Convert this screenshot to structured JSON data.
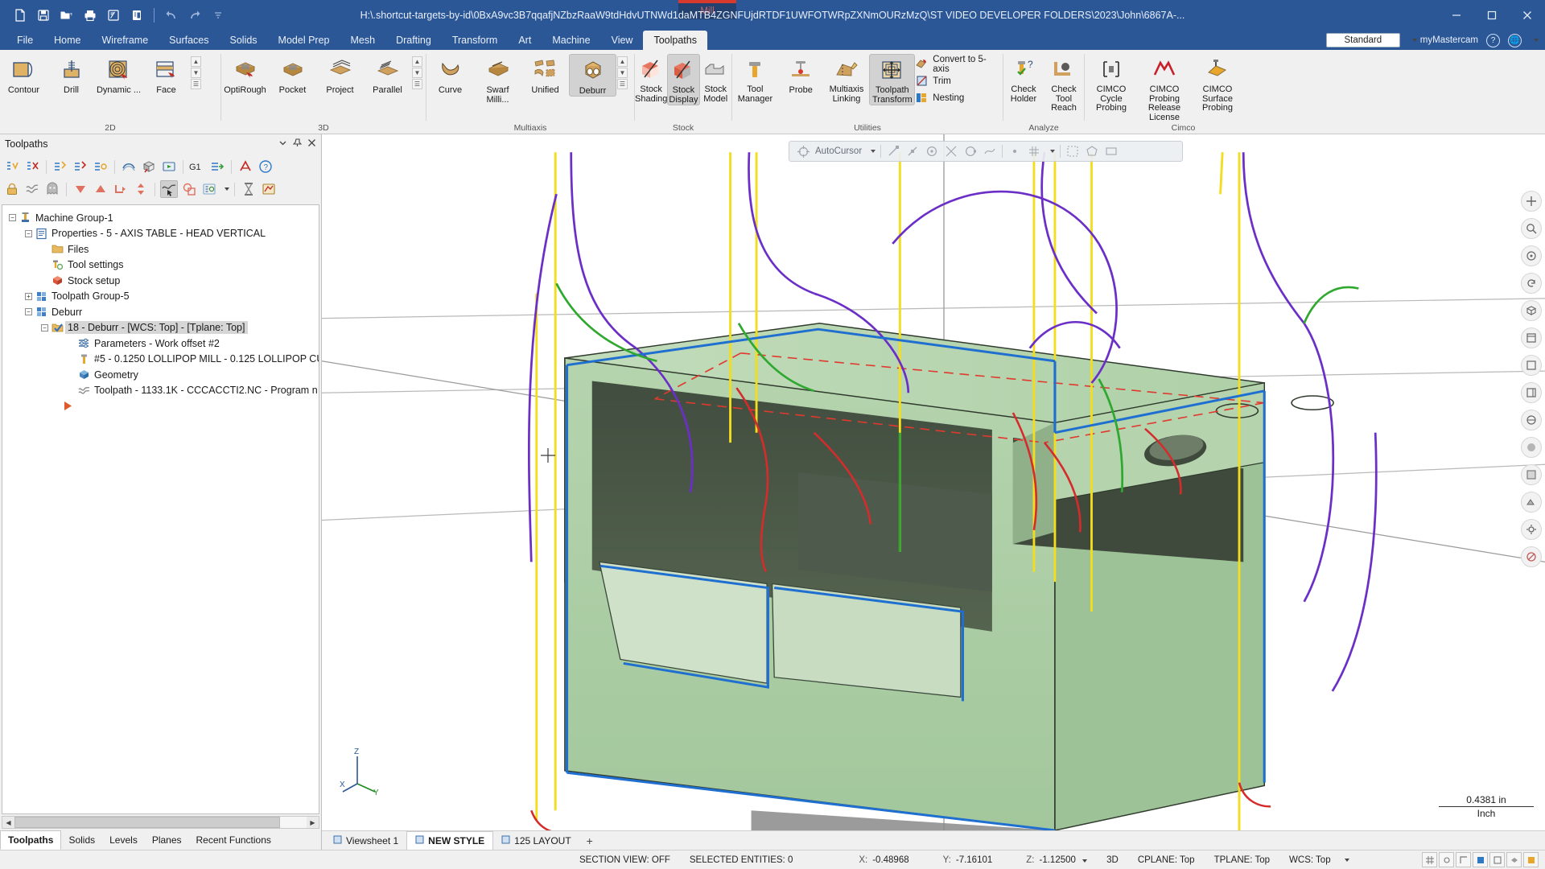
{
  "window": {
    "file_path": "H:\\.shortcut-targets-by-id\\0BxA9vc3B7qqafjNZbzRaaW9tdHdvUTNWd1daMTB4ZGNFUjdRTDF1UWFOTWRpZXNmOURzMzQ\\ST VIDEO DEVELOPER FOLDERS\\2023\\John\\6867A-...",
    "mill_tab": "Mill",
    "minimize": "–",
    "maximize": "❐",
    "close": "✕"
  },
  "quick_access": [
    {
      "name": "new-file",
      "icon": "document-icon"
    },
    {
      "name": "save",
      "icon": "floppy-icon"
    },
    {
      "name": "open",
      "icon": "folder-open-icon"
    },
    {
      "name": "print",
      "icon": "printer-icon"
    },
    {
      "name": "edit-notes",
      "icon": "note-check-icon"
    },
    {
      "name": "report",
      "icon": "report-icon"
    },
    {
      "name": "undo",
      "icon": "undo-icon"
    },
    {
      "name": "redo",
      "icon": "redo-icon"
    },
    {
      "name": "customize",
      "icon": "overflow-icon"
    }
  ],
  "ribbon_tabs": [
    {
      "label": "File",
      "active": false
    },
    {
      "label": "Home",
      "active": false
    },
    {
      "label": "Wireframe",
      "active": false
    },
    {
      "label": "Surfaces",
      "active": false
    },
    {
      "label": "Solids",
      "active": false
    },
    {
      "label": "Model Prep",
      "active": false
    },
    {
      "label": "Mesh",
      "active": false
    },
    {
      "label": "Drafting",
      "active": false
    },
    {
      "label": "Transform",
      "active": false
    },
    {
      "label": "Art",
      "active": false
    },
    {
      "label": "Machine",
      "active": false
    },
    {
      "label": "View",
      "active": false
    },
    {
      "label": "Toolpaths",
      "active": true
    }
  ],
  "tabstrip_right": {
    "config_selector": "Standard",
    "account": "myMastercam",
    "help_icon": "question-circle-icon",
    "globe_icon": "globe-icon",
    "caret_icon": "chevron-down-icon"
  },
  "ribbon_groups": [
    {
      "name": "2D",
      "label": "2D",
      "buttons": [
        {
          "label": "Contour",
          "icon": "contour-icon"
        },
        {
          "label": "Drill",
          "icon": "drill-icon"
        },
        {
          "label": "Dynamic ...",
          "icon": "dynamic-mill-icon"
        },
        {
          "label": "Face",
          "icon": "face-icon"
        }
      ],
      "has_scroll": true
    },
    {
      "name": "3D",
      "label": "3D",
      "buttons": [
        {
          "label": "OptiRough",
          "icon": "optirough-icon"
        },
        {
          "label": "Pocket",
          "icon": "pocket-3d-icon"
        },
        {
          "label": "Project",
          "icon": "project-icon"
        },
        {
          "label": "Parallel",
          "icon": "parallel-icon"
        }
      ],
      "has_scroll": true
    },
    {
      "name": "Multiaxis",
      "label": "Multiaxis",
      "buttons": [
        {
          "label": "Curve",
          "icon": "curve-icon"
        },
        {
          "label": "Swarf Milli...",
          "icon": "swarf-icon"
        },
        {
          "label": "Unified",
          "icon": "unified-icon"
        },
        {
          "label": "Deburr",
          "icon": "deburr-icon",
          "selected": true
        }
      ],
      "has_scroll": true
    },
    {
      "name": "Stock",
      "label": "Stock",
      "buttons": [
        {
          "label": "Stock Shading",
          "icon": "stock-shading-icon"
        },
        {
          "label": "Stock Display",
          "icon": "stock-display-icon",
          "selected": true
        },
        {
          "label": "Stock Model",
          "icon": "stock-model-icon",
          "dropdown": true
        }
      ]
    },
    {
      "name": "Utilities",
      "label": "Utilities",
      "buttons": [
        {
          "label": "Tool Manager",
          "icon": "tool-manager-icon"
        },
        {
          "label": "Probe",
          "icon": "probe-icon"
        },
        {
          "label": "Multiaxis Linking",
          "icon": "multiaxis-linking-icon"
        },
        {
          "label": "Toolpath Transform",
          "icon": "toolpath-transform-icon"
        }
      ],
      "small_buttons": [
        {
          "label": "Convert to 5-axis",
          "icon": "convert-5axis-icon"
        },
        {
          "label": "Trim",
          "icon": "trim-icon"
        },
        {
          "label": "Nesting",
          "icon": "nesting-icon"
        }
      ]
    },
    {
      "name": "Analyze",
      "label": "Analyze",
      "buttons": [
        {
          "label": "Check Holder",
          "icon": "check-holder-icon"
        },
        {
          "label": "Check Tool Reach",
          "icon": "check-tool-reach-icon"
        }
      ]
    },
    {
      "name": "Cimco",
      "label": "Cimco",
      "buttons": [
        {
          "label": "CIMCO Cycle Probing",
          "icon": "cimco-cycle-probing-icon"
        },
        {
          "label": "CIMCO Probing Release License",
          "icon": "cimco-release-license-icon"
        },
        {
          "label": "CIMCO Surface Probing",
          "icon": "cimco-surface-probing-icon"
        }
      ]
    }
  ],
  "toolpaths_panel": {
    "title": "Toolpaths",
    "header_buttons": [
      {
        "name": "panel-options",
        "icon": "chevron-down-icon"
      },
      {
        "name": "panel-pin",
        "icon": "pin-icon"
      },
      {
        "name": "panel-close",
        "icon": "close-icon"
      }
    ],
    "toolbar_row1": [
      {
        "name": "select-all-toolpaths",
        "icon": "select-all-icon"
      },
      {
        "name": "deselect-all-toolpaths",
        "icon": "deselect-all-icon"
      },
      {
        "name": "regen-dirty",
        "icon": "regen-dirty-icon"
      },
      {
        "name": "regen-all-dirty",
        "icon": "regen-all-dirty-icon"
      },
      {
        "name": "regen-selected",
        "icon": "regen-selected-icon"
      },
      {
        "name": "backplot",
        "icon": "backplot-icon"
      },
      {
        "name": "verify",
        "icon": "verify-icon"
      },
      {
        "name": "simulate",
        "icon": "simulate-icon"
      },
      {
        "name": "post-g1",
        "icon": "post-g1-icon"
      },
      {
        "name": "transfer",
        "icon": "transfer-icon"
      },
      {
        "name": "highfeed",
        "icon": "highfeed-icon"
      },
      {
        "name": "help",
        "icon": "help-icon"
      }
    ],
    "toolbar_row2": [
      {
        "name": "lock-toolpath",
        "icon": "lock-icon"
      },
      {
        "name": "toggle-posting",
        "icon": "waves-icon"
      },
      {
        "name": "toggle-display",
        "icon": "ghost-icon"
      },
      {
        "name": "move-down",
        "icon": "triangle-down-icon"
      },
      {
        "name": "move-up",
        "icon": "triangle-up-icon"
      },
      {
        "name": "insert-after",
        "icon": "insert-arrow-icon"
      },
      {
        "name": "move-updown",
        "icon": "updown-icon"
      },
      {
        "name": "only-selected",
        "icon": "only-selected-icon",
        "active": true
      },
      {
        "name": "geometry-only",
        "icon": "geometry-only-icon"
      },
      {
        "name": "list-options",
        "icon": "list-options-icon",
        "dropdown": true
      },
      {
        "name": "time-estimate",
        "icon": "hourglass-icon"
      },
      {
        "name": "advanced-display",
        "icon": "advanced-display-icon"
      }
    ],
    "tree": [
      {
        "indent": 0,
        "expander": "-",
        "icon": "machine-group-icon",
        "label": "Machine Group-1"
      },
      {
        "indent": 1,
        "expander": "-",
        "icon": "properties-icon",
        "label": "Properties - 5 - AXIS TABLE - HEAD VERTICAL"
      },
      {
        "indent": 2,
        "expander": "",
        "icon": "folder-icon",
        "label": "Files"
      },
      {
        "indent": 2,
        "expander": "",
        "icon": "tool-settings-icon",
        "label": "Tool settings"
      },
      {
        "indent": 2,
        "expander": "",
        "icon": "stock-setup-icon",
        "label": "Stock setup"
      },
      {
        "indent": 1,
        "expander": "+",
        "icon": "toolpath-group-icon",
        "label": "Toolpath Group-5"
      },
      {
        "indent": 1,
        "expander": "-",
        "icon": "toolpath-group-icon",
        "label": "Deburr"
      },
      {
        "indent": 2,
        "expander": "-",
        "icon": "operation-icon",
        "label": "18 - Deburr - [WCS: Top] - [Tplane: Top]",
        "selected": true
      },
      {
        "indent": 3,
        "expander": "",
        "icon": "parameters-icon",
        "label": "Parameters - Work offset #2"
      },
      {
        "indent": 3,
        "expander": "",
        "icon": "tool-icon",
        "label": "#5 - 0.1250 LOLLIPOP MILL - 0.125 LOLLIPOP CU"
      },
      {
        "indent": 3,
        "expander": "",
        "icon": "geometry-icon",
        "label": "Geometry"
      },
      {
        "indent": 3,
        "expander": "",
        "icon": "toolpath-waves-icon",
        "label": "Toolpath - 1133.1K - CCCACCTI2.NC - Program n"
      },
      {
        "indent": 2,
        "expander": "",
        "icon": "insert-marker-icon",
        "label": ""
      }
    ],
    "bottom_tabs": [
      {
        "label": "Toolpaths",
        "active": true
      },
      {
        "label": "Solids",
        "active": false
      },
      {
        "label": "Levels",
        "active": false
      },
      {
        "label": "Planes",
        "active": false
      },
      {
        "label": "Recent Functions",
        "active": false
      }
    ]
  },
  "viewport": {
    "autocursor_label": "AutoCursor",
    "scale_value": "0.4381 in",
    "scale_unit": "Inch",
    "axis_labels": {
      "x": "X",
      "y": "Y",
      "z": "Z"
    },
    "toolbar_icons": [
      {
        "name": "autocursor-target-icon"
      },
      {
        "name": "autocursor-chevron-icon"
      },
      {
        "name": "endpoint-snap-icon"
      },
      {
        "name": "midpoint-snap-icon"
      },
      {
        "name": "center-snap-icon"
      },
      {
        "name": "intersection-snap-icon"
      },
      {
        "name": "quadrant-snap-icon"
      },
      {
        "name": "nearest-snap-icon"
      },
      {
        "name": "point-snap-icon"
      },
      {
        "name": "grid-snap-icon"
      },
      {
        "name": "relative-snap-icon"
      },
      {
        "name": "select-mode-icon"
      },
      {
        "name": "polygon-select-icon"
      },
      {
        "name": "window-select-icon"
      }
    ],
    "right_rail_icons": [
      {
        "name": "fit-screen-icon"
      },
      {
        "name": "zoom-window-icon"
      },
      {
        "name": "zoom-target-icon"
      },
      {
        "name": "dynamic-rotate-icon"
      },
      {
        "name": "isometric-view-icon"
      },
      {
        "name": "top-view-icon"
      },
      {
        "name": "front-view-icon"
      },
      {
        "name": "right-view-icon"
      },
      {
        "name": "wireframe-shade-icon"
      },
      {
        "name": "shaded-icon"
      },
      {
        "name": "translucency-icon"
      },
      {
        "name": "material-icon"
      },
      {
        "name": "settings-gear-icon"
      },
      {
        "name": "blank-icon"
      }
    ],
    "view_tabs": [
      {
        "label": "Viewsheet 1",
        "active": false,
        "icon": "viewsheet-icon"
      },
      {
        "label": "NEW STYLE",
        "active": true,
        "icon": "viewsheet-icon"
      },
      {
        "label": "125 LAYOUT",
        "active": false,
        "icon": "viewsheet-icon"
      }
    ],
    "add_tab": "+"
  },
  "status_bar": {
    "section_view": "SECTION VIEW: OFF",
    "selected_entities": "SELECTED ENTITIES: 0",
    "coords": [
      {
        "label": "X:",
        "value": "-0.48968"
      },
      {
        "label": "Y:",
        "value": "-7.16101"
      },
      {
        "label": "Z:",
        "value": "-1.12500"
      }
    ],
    "mode": "3D",
    "cplane": "CPLANE: Top",
    "tplane": "TPLANE: Top",
    "wcs": "WCS: Top",
    "right_icons": [
      {
        "name": "status-grid-icon"
      },
      {
        "name": "status-snap-icon"
      },
      {
        "name": "status-ortho-icon"
      },
      {
        "name": "status-shade-icon"
      },
      {
        "name": "status-wire-icon"
      },
      {
        "name": "status-layer-icon"
      },
      {
        "name": "status-color-icon"
      }
    ]
  },
  "colors": {
    "title_blue": "#2b5797",
    "ribbon_bg": "#f0f0f0",
    "part_green": "#a9cfa4",
    "part_dark": "#4e5b4c",
    "toolpath_yellow": "#f5e642",
    "toolpath_purple": "#6a2fc4",
    "toolpath_blue": "#1f6fd0",
    "toolpath_red": "#d62b2b",
    "toolpath_green": "#2ea02e",
    "selection_gray": "#d6d6d6"
  }
}
